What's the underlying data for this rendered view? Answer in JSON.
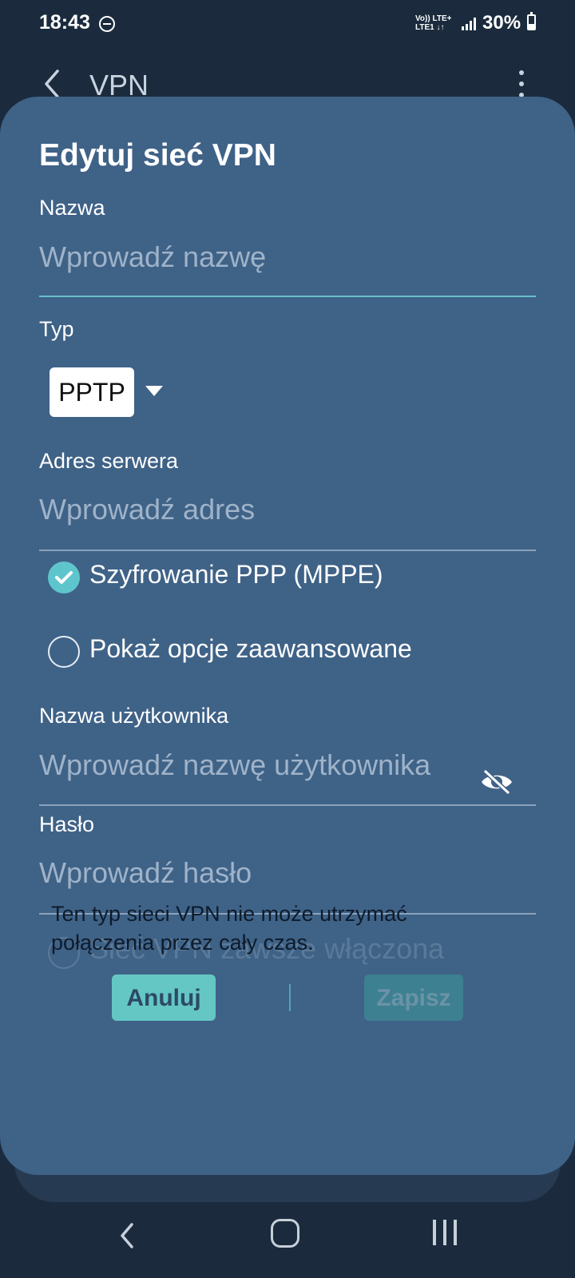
{
  "status_bar": {
    "time": "18:43",
    "network_top": "Vo)) LTE+",
    "network_bottom": "LTE1 ↓↑",
    "battery": "30%"
  },
  "app_bar": {
    "title": "VPN"
  },
  "dialog": {
    "title": "Edytuj sieć VPN",
    "name_label": "Nazwa",
    "name_placeholder": "Wprowadź nazwę",
    "type_label": "Typ",
    "type_value": "PPTP",
    "server_label": "Adres serwera",
    "server_placeholder": "Wprowadź adres",
    "ppp_encryption_label": "Szyfrowanie PPP (MPPE)",
    "ppp_encryption_checked": true,
    "advanced_options_label": "Pokaż opcje zaawansowane",
    "advanced_options_checked": false,
    "username_label": "Nazwa użytkownika",
    "username_placeholder": "Wprowadź nazwę użytkownika",
    "password_label": "Hasło",
    "password_placeholder": "Wprowadź hasło",
    "always_on_label": "Sieć VPN zawsze włączona",
    "always_on_info": "Ten typ sieci VPN nie może utrzymać połączenia przez cały czas.",
    "cancel_label": "Anuluj",
    "save_label": "Zapisz"
  },
  "colors": {
    "background": "#1b2b3d",
    "dialog": "#3f6287",
    "accent": "#5fc5cc"
  }
}
